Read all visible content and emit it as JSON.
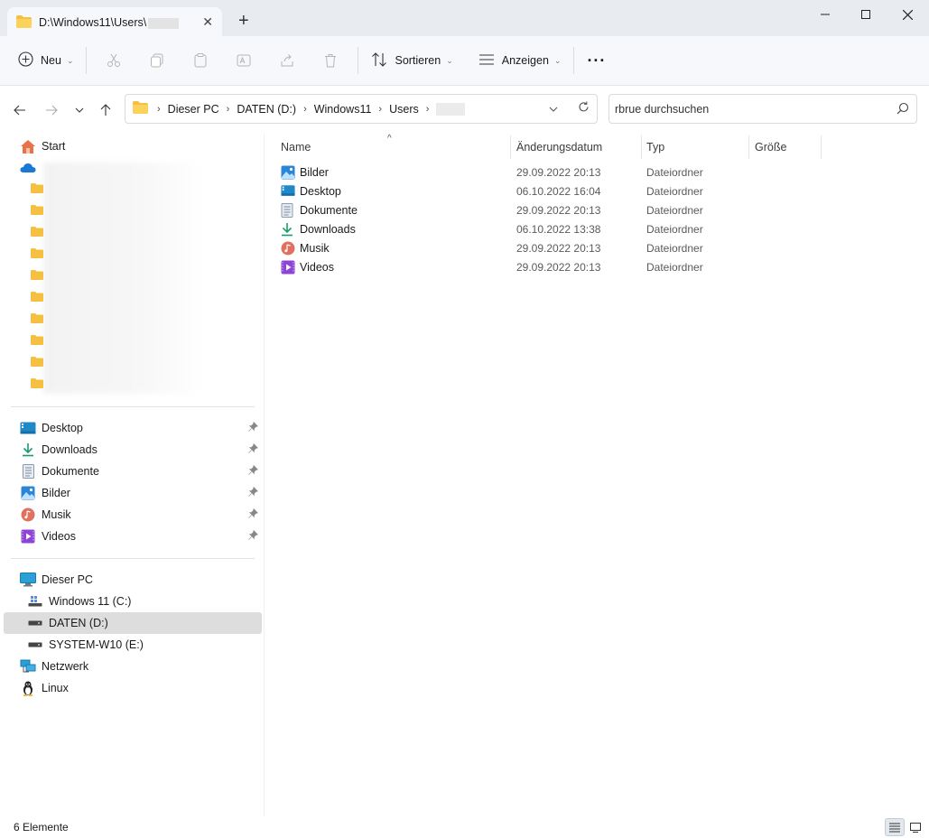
{
  "window": {
    "tab_title": "D:\\Windows11\\Users\\",
    "new_tab_label": "+",
    "tab_close_label": "✕"
  },
  "toolbar": {
    "new_label": "Neu",
    "sort_label": "Sortieren",
    "view_label": "Anzeigen",
    "more_label": "···"
  },
  "address": {
    "crumbs": [
      "Dieser PC",
      "DATEN (D:)",
      "Windows11",
      "Users"
    ],
    "search_placeholder": "rbrue durchsuchen"
  },
  "sidebar": {
    "home_label": "Start",
    "pinned": [
      {
        "label": "Desktop",
        "icon": "desktop-icon"
      },
      {
        "label": "Downloads",
        "icon": "download-icon"
      },
      {
        "label": "Dokumente",
        "icon": "document-icon"
      },
      {
        "label": "Bilder",
        "icon": "pictures-icon"
      },
      {
        "label": "Musik",
        "icon": "music-icon"
      },
      {
        "label": "Videos",
        "icon": "video-icon"
      }
    ],
    "this_pc_label": "Dieser PC",
    "drives": [
      {
        "label": "Windows 11 (C:)",
        "icon": "windows-drive-icon"
      },
      {
        "label": "DATEN (D:)",
        "icon": "drive-icon",
        "selected": true
      },
      {
        "label": "SYSTEM-W10 (E:)",
        "icon": "drive-icon"
      }
    ],
    "network_label": "Netzwerk",
    "linux_label": "Linux"
  },
  "columns": {
    "name": "Name",
    "date": "Änderungsdatum",
    "type": "Typ",
    "size": "Größe"
  },
  "files": [
    {
      "name": "Bilder",
      "date": "29.09.2022 20:13",
      "type": "Dateiordner",
      "icon": "pictures-icon"
    },
    {
      "name": "Desktop",
      "date": "06.10.2022 16:04",
      "type": "Dateiordner",
      "icon": "desktop-icon"
    },
    {
      "name": "Dokumente",
      "date": "29.09.2022 20:13",
      "type": "Dateiordner",
      "icon": "document-icon"
    },
    {
      "name": "Downloads",
      "date": "06.10.2022 13:38",
      "type": "Dateiordner",
      "icon": "download-icon"
    },
    {
      "name": "Musik",
      "date": "29.09.2022 20:13",
      "type": "Dateiordner",
      "icon": "music-icon"
    },
    {
      "name": "Videos",
      "date": "29.09.2022 20:13",
      "type": "Dateiordner",
      "icon": "video-icon"
    }
  ],
  "status": {
    "item_count": "6 Elemente"
  },
  "colors": {
    "folder_yellow": "#f5c042",
    "accent_blue": "#0067c0",
    "selected_bg": "#dddddd"
  }
}
